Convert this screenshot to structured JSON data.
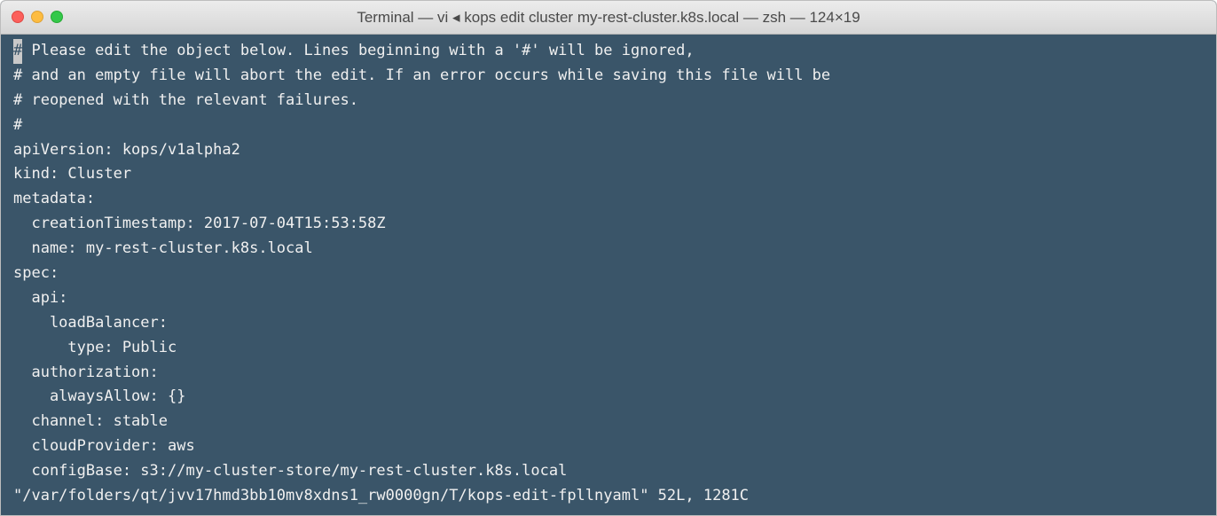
{
  "window": {
    "title": "Terminal — vi ◂ kops edit cluster my-rest-cluster.k8s.local — zsh — 124×19"
  },
  "editor": {
    "cursor_char": "#",
    "lines": [
      " Please edit the object below. Lines beginning with a '#' will be ignored,",
      "# and an empty file will abort the edit. If an error occurs while saving this file will be",
      "# reopened with the relevant failures.",
      "#",
      "apiVersion: kops/v1alpha2",
      "kind: Cluster",
      "metadata:",
      "  creationTimestamp: 2017-07-04T15:53:58Z",
      "  name: my-rest-cluster.k8s.local",
      "spec:",
      "  api:",
      "    loadBalancer:",
      "      type: Public",
      "  authorization:",
      "    alwaysAllow: {}",
      "  channel: stable",
      "  cloudProvider: aws",
      "  configBase: s3://my-cluster-store/my-rest-cluster.k8s.local"
    ],
    "status_line": "\"/var/folders/qt/jvv17hmd3bb10mv8xdns1_rw0000gn/T/kops-edit-fpllnyaml\" 52L, 1281C"
  },
  "colors": {
    "background": "#3a5569",
    "foreground": "#f0f0f0",
    "cursor": "#c9c9c9"
  },
  "icons": [
    "close-button",
    "minimize-button",
    "zoom-button"
  ]
}
